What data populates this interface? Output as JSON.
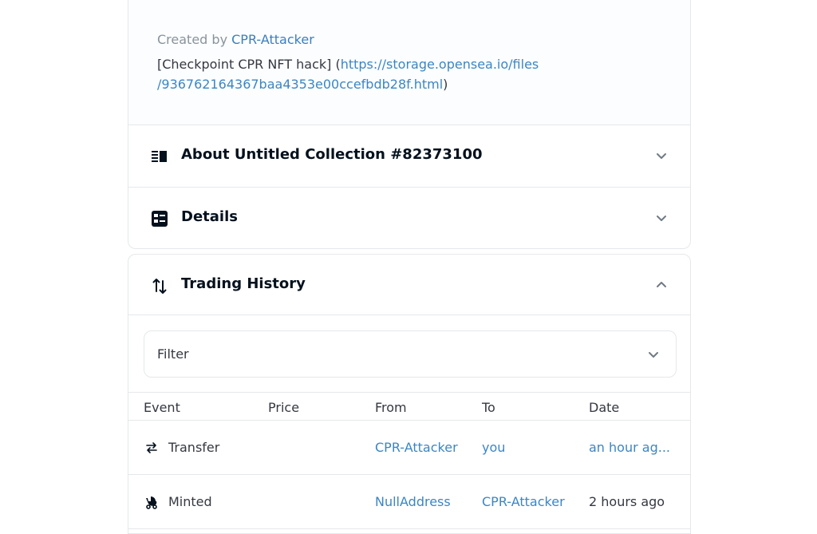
{
  "description": {
    "created_by_label": "Created by",
    "creator": "CPR-Attacker",
    "line1_text": "[Checkpoint CPR NFT hack] (",
    "line1_link": "https://storage.opensea.io/files",
    "line2_link": "/936762164367baa4353e00ccefbdb28f.html",
    "line2_close": ")"
  },
  "sections": {
    "about": {
      "title": "About Untitled Collection #82373100",
      "icon": "text-align-icon"
    },
    "details": {
      "title": "Details",
      "icon": "details-list-icon"
    },
    "trading": {
      "title": "Trading History",
      "icon": "swap-vertical-icon"
    }
  },
  "filter": {
    "label": "Filter"
  },
  "table": {
    "columns": [
      "Event",
      "Price",
      "From",
      "To",
      "Date"
    ],
    "rows": [
      {
        "event": "Transfer",
        "icon": "transfer-icon",
        "price": "",
        "from": "CPR-Attacker",
        "to": "you",
        "date": "an hour ag..."
      },
      {
        "event": "Minted",
        "icon": "stroller-icon",
        "price": "",
        "from": "NullAddress",
        "to": "CPR-Attacker",
        "date": "2 hours ago"
      }
    ]
  },
  "colors": {
    "link": "#3b86c4",
    "border": "#e5e8eb",
    "title": "#04111d"
  }
}
